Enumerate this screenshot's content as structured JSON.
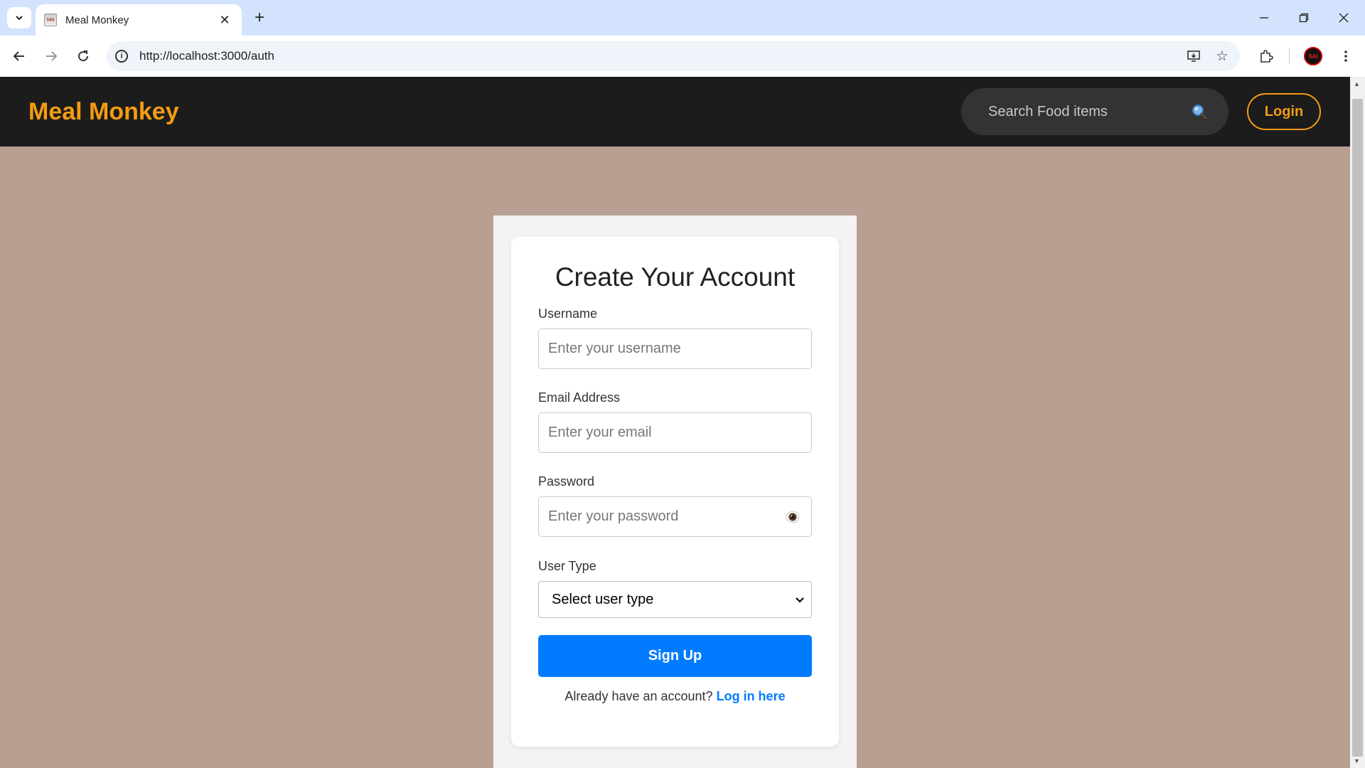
{
  "browser": {
    "tab_title": "Meal Monkey",
    "favicon_text": "MM",
    "url": "http://localhost:3000/auth",
    "avatar_text": "SAI"
  },
  "header": {
    "brand": "Meal Monkey",
    "search_placeholder": "Search Food items",
    "login_label": "Login"
  },
  "form": {
    "title": "Create Your Account",
    "username_label": "Username",
    "username_placeholder": "Enter your username",
    "email_label": "Email Address",
    "email_placeholder": "Enter your email",
    "password_label": "Password",
    "password_placeholder": "Enter your password",
    "user_type_label": "User Type",
    "user_type_selected": "Select user type",
    "signup_label": "Sign Up",
    "login_prompt": "Already have an account?",
    "login_link": "Log in here"
  },
  "colors": {
    "brand": "#f39c12",
    "page_bg": "#b89f92",
    "header_bg": "#1c1c1c",
    "primary_button": "#007bff"
  },
  "icons": {
    "search": "magnifier-icon",
    "password_toggle": "eye-icon"
  }
}
